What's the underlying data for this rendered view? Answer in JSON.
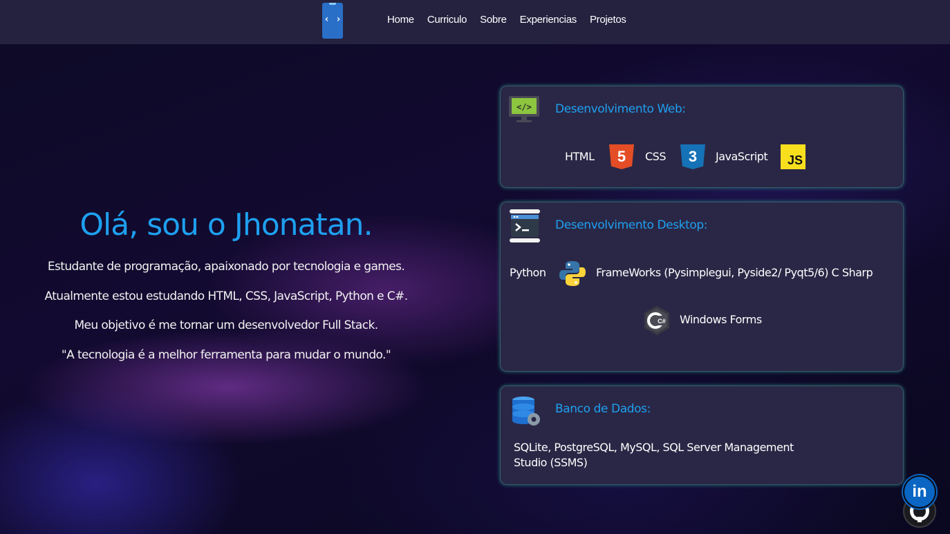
{
  "nav": {
    "logo_glyph": "‹ ›",
    "links": [
      "Home",
      "Curriculo",
      "Sobre",
      "Experiencias",
      "Projetos"
    ]
  },
  "hero": {
    "title": "Olá, sou o Jhonatan.",
    "lines": [
      "Estudante de programação, apaixonado por tecnologia e games.",
      "Atualmente estou estudando HTML, CSS, JavaScript, Python e C#.",
      "Meu objetivo é me tornar um desenvolvedor Full Stack.",
      "\"A tecnologia é a melhor ferramenta para mudar o mundo.\""
    ]
  },
  "cards": {
    "web": {
      "title": "Desenvolvimento Web:",
      "icon": "code-monitor-icon",
      "items": [
        "HTML",
        "CSS",
        "JavaScript"
      ],
      "html_badge": "5",
      "css_badge": "3",
      "js_badge": "JS"
    },
    "desktop": {
      "title": "Desenvolvimento Desktop:",
      "icon": "terminal-icon",
      "python": "Python",
      "frameworks": "FrameWorks (Pysimplegui, Pyside2/ Pyqt5/6) C Sharp",
      "csharp_badge": "C#",
      "winforms": "Windows Forms"
    },
    "database": {
      "title": "Banco de Dados:",
      "icon": "database-icon",
      "text_line1": "SQLite, PostgreSQL, MySQL, SQL Server Management",
      "text_line2": "Studio (SSMS)"
    }
  },
  "social": {
    "linkedin": "in",
    "github_icon": "github-icon"
  },
  "colors": {
    "accent": "#1ea0f0",
    "nav_bg": "#24223f",
    "card_bg": "#2a2746",
    "card_glow": "#3cc8aa"
  }
}
